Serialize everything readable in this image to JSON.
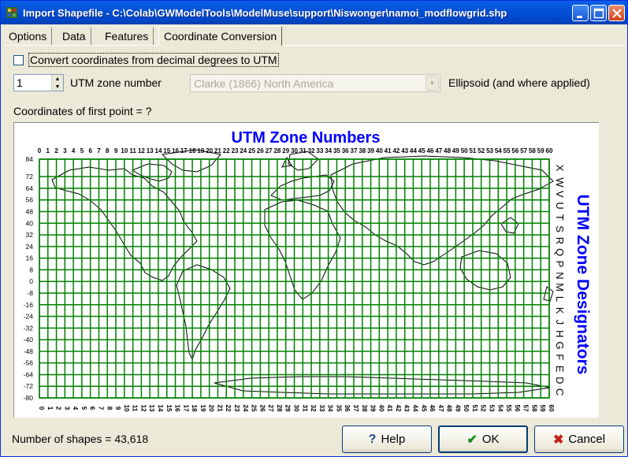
{
  "window": {
    "title": "Import Shapefile - C:\\Colab\\GWModelTools\\ModelMuse\\support\\Niswonger\\namoi_modflowgrid.shp"
  },
  "tabs": [
    {
      "label": "Options"
    },
    {
      "label": "Data"
    },
    {
      "label": "Features"
    },
    {
      "label": "Coordinate Conversion"
    }
  ],
  "conversion": {
    "checkbox_label": "Convert coordinates from decimal degrees to UTM",
    "checked": false,
    "utm_zone_value": "1",
    "utm_zone_label": "UTM zone number",
    "ellipsoid_value": "Clarke (1866) North America",
    "ellipsoid_label": "Ellipsoid (and where applied)",
    "first_point_label": "Coordinates of first point = ?"
  },
  "map": {
    "title": "UTM Zone Numbers",
    "side_title": "UTM Zone Designators",
    "zone_numbers": [
      "0",
      "1",
      "2",
      "3",
      "4",
      "5",
      "6",
      "7",
      "8",
      "9",
      "10",
      "11",
      "12",
      "13",
      "14",
      "15",
      "16",
      "17",
      "18",
      "19",
      "20",
      "21",
      "22",
      "23",
      "24",
      "25",
      "26",
      "27",
      "28",
      "29",
      "30",
      "31",
      "32",
      "33",
      "34",
      "35",
      "36",
      "37",
      "38",
      "39",
      "40",
      "41",
      "42",
      "43",
      "44",
      "45",
      "46",
      "47",
      "48",
      "49",
      "50",
      "51",
      "52",
      "53",
      "54",
      "55",
      "56",
      "57",
      "58",
      "59",
      "60"
    ],
    "latitudes": [
      "84",
      "72",
      "64",
      "56",
      "48",
      "40",
      "32",
      "24",
      "16",
      "8",
      "0",
      "-8",
      "-16",
      "-24",
      "-32",
      "-40",
      "-48",
      "-56",
      "-64",
      "-72",
      "-80"
    ],
    "designators": [
      "X",
      "W",
      "V",
      "U",
      "T",
      "S",
      "R",
      "Q",
      "P",
      "N",
      "M",
      "L",
      "K",
      "J",
      "H",
      "G",
      "F",
      "E",
      "D",
      "C"
    ],
    "grid_color": "#008000",
    "title_color": "#0000ff"
  },
  "footer": {
    "status": "Number of shapes = 43,618",
    "help_label": "Help",
    "ok_label": "OK",
    "cancel_label": "Cancel"
  }
}
